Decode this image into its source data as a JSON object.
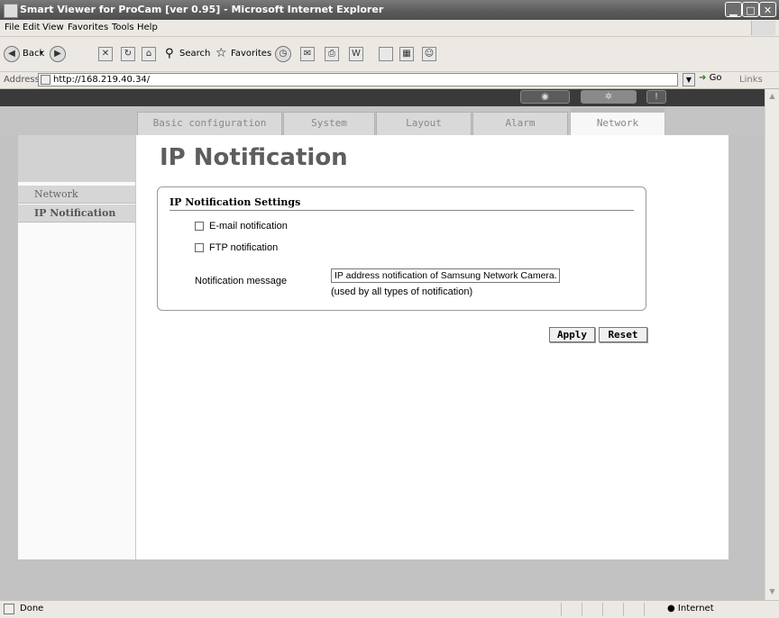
{
  "window": {
    "title": "Smart Viewer for ProCam [ver 0.95] - Microsoft Internet Explorer"
  },
  "menu": [
    "File",
    "Edit",
    "View",
    "Favorites",
    "Tools",
    "Help"
  ],
  "toolbar": {
    "back": "Back",
    "search": "Search",
    "favorites": "Favorites"
  },
  "address": {
    "label": "Address",
    "url": "http://168.219.40.34/",
    "go": "Go",
    "links": "Links"
  },
  "tabs": [
    "Basic configuration",
    "System",
    "Layout",
    "Alarm",
    "Network"
  ],
  "active_tab": "Network",
  "sidebar": {
    "items": [
      "Network",
      "IP Notification"
    ],
    "active": "IP Notification"
  },
  "main": {
    "title": "IP Notification",
    "section_title": "IP Notification Settings",
    "email_label": "E-mail notification",
    "email_checked": false,
    "ftp_label": "FTP notification",
    "ftp_checked": false,
    "message_label": "Notification message",
    "message_value": "IP address notification of Samsung Network Camera.",
    "message_note": "(used by all types of notification)",
    "apply_label": "Apply",
    "reset_label": "Reset"
  },
  "status": {
    "text": "Done",
    "zone": "Internet"
  }
}
